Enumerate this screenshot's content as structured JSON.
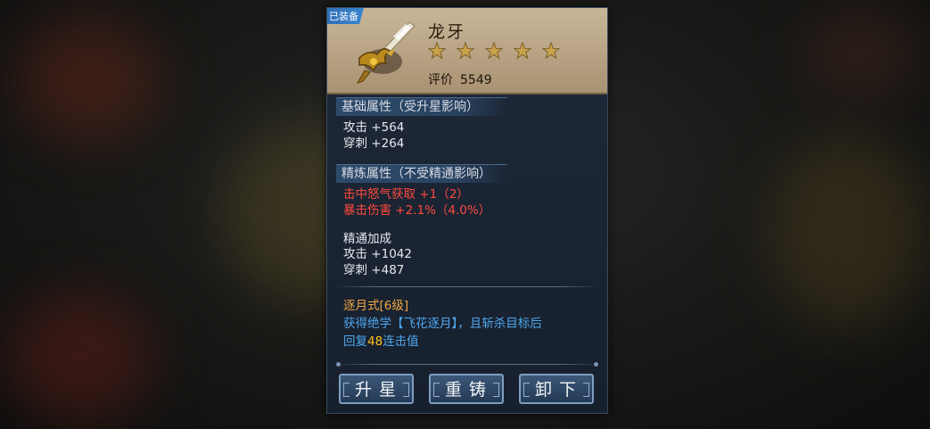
{
  "item": {
    "equipped_tag": "已装备",
    "name": "龙牙",
    "stars": 5,
    "rating_label": "评价",
    "rating_value": "5549",
    "star_color": "#c9a24b"
  },
  "base_attrs": {
    "title": "基础属性（受升星影响）",
    "lines": [
      "攻击 +564",
      "穿刺 +264"
    ]
  },
  "refine_attrs": {
    "title": "精炼属性（不受精通影响）",
    "lines": [
      "击中怒气获取 +1（2）",
      "暴击伤害 +2.1%（4.0%）"
    ]
  },
  "mastery": {
    "title": "精通加成",
    "lines": [
      "攻击 +1042",
      "穿刺 +487"
    ]
  },
  "skill": {
    "name": "逐月式[6级]",
    "desc_line1": "获得绝学【飞花逐月】，且斩杀目标后",
    "desc_line2_prefix": "回复",
    "desc_line2_value": "48",
    "desc_line2_suffix": "连击值"
  },
  "buttons": {
    "upgrade_star": "升星",
    "recast": "重铸",
    "unequip": "卸下"
  }
}
